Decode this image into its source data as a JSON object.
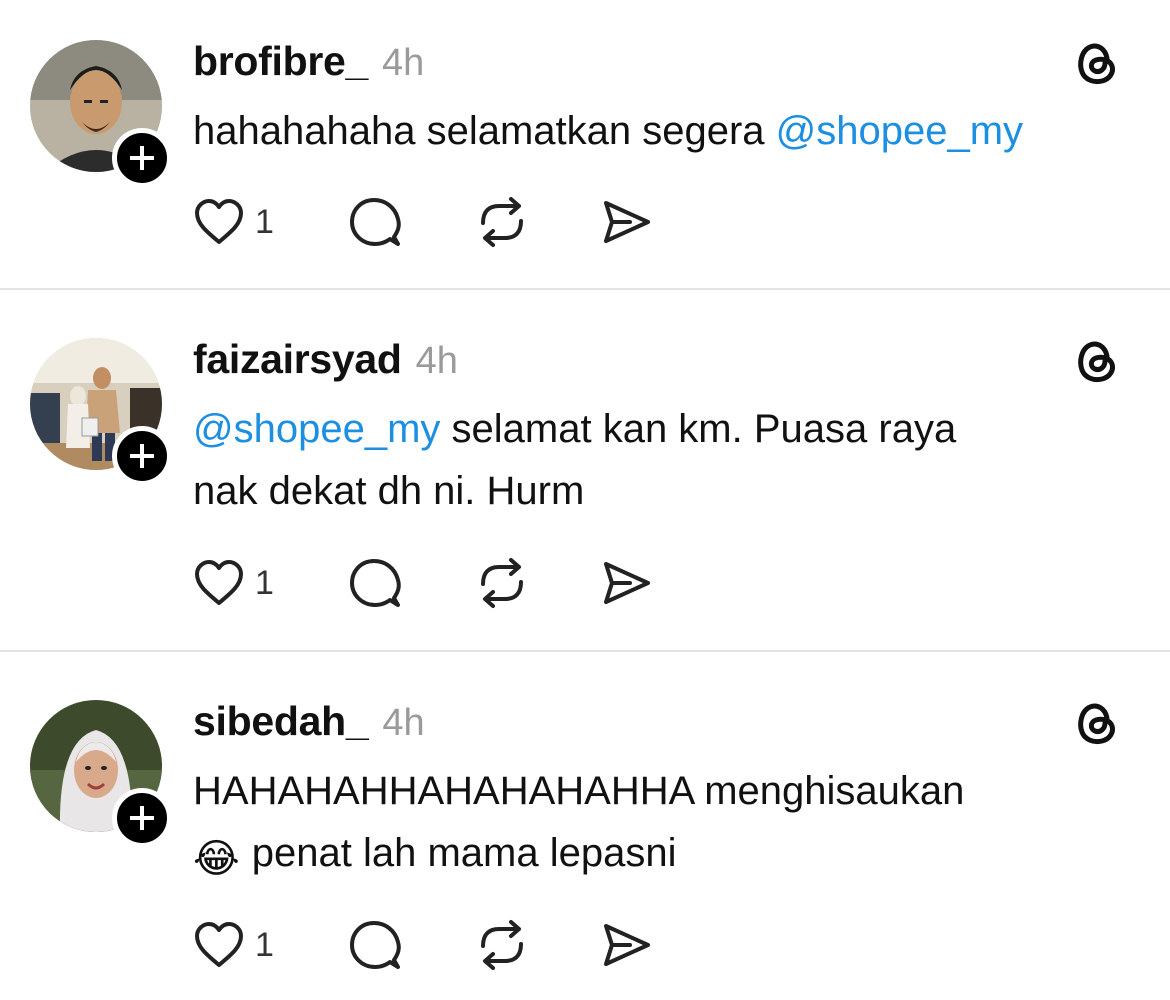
{
  "posts": [
    {
      "username": "brofibre_",
      "time": "4h",
      "text_parts": [
        {
          "text": "hahahahaha selamatkan segera ",
          "mention": false
        },
        {
          "text": "@shopee_my",
          "mention": true
        }
      ],
      "likes": "1",
      "follow_symbol": "+",
      "icons": [
        "threads-logo-icon",
        "heart-icon",
        "comment-icon",
        "repost-icon",
        "share-icon"
      ]
    },
    {
      "username": "faizairsyad",
      "time": "4h",
      "text_line1_mention": "@shopee_my",
      "text_line1_rest": " selamat kan km. Puasa raya",
      "text_line2": "nak dekat dh ni. Hurm",
      "likes": "1",
      "follow_symbol": "+"
    },
    {
      "username": "sibedah_",
      "time": "4h",
      "text_line1": "HAHAHAHHAHAHAHAHHA menghisaukan",
      "text_line2_emoji": "😂",
      "text_line2": "penat lah mama lepasni",
      "likes": "1",
      "follow_symbol": "+"
    }
  ],
  "colors": {
    "mention": "#1d8fe0",
    "timestamp": "#9a9a9a",
    "divider": "#e4e4e4"
  }
}
